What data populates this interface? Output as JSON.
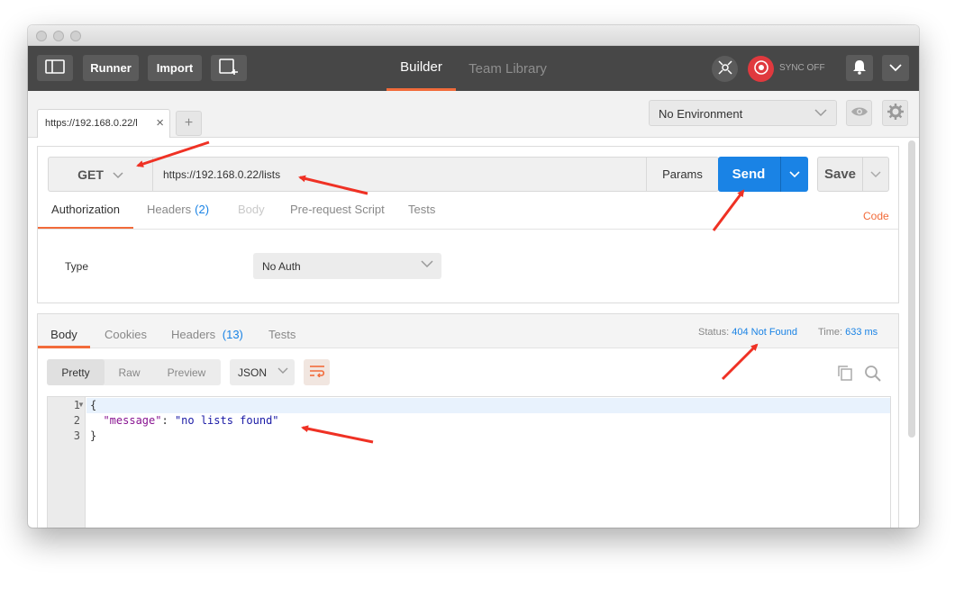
{
  "header": {
    "runner_label": "Runner",
    "import_label": "Import",
    "nav_tabs": [
      {
        "label": "Builder",
        "active": true
      },
      {
        "label": "Team Library",
        "active": false
      }
    ],
    "sync_label": "SYNC OFF"
  },
  "tabs": {
    "request_tab_label": "https://192.168.0.22/l",
    "close_symbol": "×",
    "add_symbol": "+"
  },
  "environment": {
    "selected": "No Environment"
  },
  "request": {
    "method": "GET",
    "url": "https://192.168.0.22/lists",
    "params_label": "Params",
    "send_label": "Send",
    "save_label": "Save",
    "subtabs": [
      {
        "label": "Authorization",
        "count": null,
        "state": "active"
      },
      {
        "label": "Headers",
        "count": "(2)",
        "state": "normal"
      },
      {
        "label": "Body",
        "count": null,
        "state": "disabled"
      },
      {
        "label": "Pre-request Script",
        "count": null,
        "state": "normal"
      },
      {
        "label": "Tests",
        "count": null,
        "state": "normal"
      }
    ],
    "code_link": "Code",
    "auth": {
      "type_label": "Type",
      "selected": "No Auth"
    }
  },
  "response": {
    "tabs": [
      {
        "label": "Body",
        "count": null,
        "active": true
      },
      {
        "label": "Cookies",
        "count": null,
        "active": false
      },
      {
        "label": "Headers",
        "count": "(13)",
        "active": false
      },
      {
        "label": "Tests",
        "count": null,
        "active": false
      }
    ],
    "status_label": "Status:",
    "status_value": "404 Not Found",
    "time_label": "Time:",
    "time_value": "633 ms",
    "view_modes": [
      "Pretty",
      "Raw",
      "Preview"
    ],
    "active_view": "Pretty",
    "format": "JSON",
    "body_lines": [
      {
        "number": "1",
        "text": "{"
      },
      {
        "number": "2",
        "key": "\"message\"",
        "sep": ": ",
        "value": "\"no lists found\""
      },
      {
        "number": "3",
        "text": "}"
      }
    ]
  },
  "colors": {
    "accent": "#f26b3a",
    "send": "#1a83e5",
    "header_bg": "#474747",
    "link": "#1a83e5",
    "annotation_arrow": "#ef3124"
  },
  "icons": [
    "sidebar-toggle-icon",
    "new-tab-icon",
    "interceptor-icon",
    "sync-icon",
    "bell-icon",
    "chevron-down-icon",
    "eye-icon",
    "gear-icon",
    "wrap-icon",
    "copy-icon",
    "search-icon"
  ]
}
